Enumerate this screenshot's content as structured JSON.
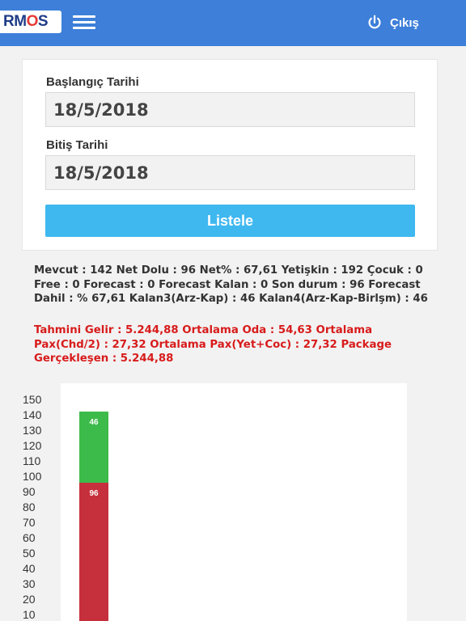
{
  "header": {
    "logo_prefix": "RM",
    "logo_accent": "O",
    "logo_suffix": "S",
    "logout_label": "Çıkış"
  },
  "form": {
    "start_label": "Başlangıç Tarihi",
    "start_value": "18/5/2018",
    "end_label": "Bitiş Tarihi",
    "end_value": "18/5/2018",
    "submit_label": "Listele"
  },
  "summary": {
    "line1": "Mevcut : 142 Net Dolu : 96 Net% : 67,61 Yetişkin : 192 Çocuk : 0 Free : 0 Forecast : 0 Forecast Kalan : 0 Son durum : 96 Forecast Dahil : % 67,61 Kalan3(Arz-Kap) : 46 Kalan4(Arz-Kap-Birlşm) : 46",
    "line2": "Tahmini Gelir : 5.244,88 Ortalama Oda : 54,63 Ortalama Pax(Chd/2) : 27,32 Ortalama Pax(Yet+Coc) : 27,32 Package Gerçekleşen : 5.244,88"
  },
  "colors": {
    "header_bg": "#3d7fd9",
    "button_bg": "#3fb8f0",
    "red_text": "#d81b1b",
    "bar_green": "#3dbb4a",
    "bar_red": "#c62f3c"
  },
  "chart_data": {
    "type": "bar",
    "stacked": true,
    "y_ticks": [
      150,
      140,
      130,
      120,
      110,
      100,
      90,
      80,
      70,
      60,
      50,
      40,
      30,
      20,
      10
    ],
    "series": [
      {
        "values": [
          96
        ],
        "color": "#c62f3c",
        "label": "96"
      },
      {
        "values": [
          46
        ],
        "color": "#3dbb4a",
        "label": "46"
      }
    ]
  }
}
